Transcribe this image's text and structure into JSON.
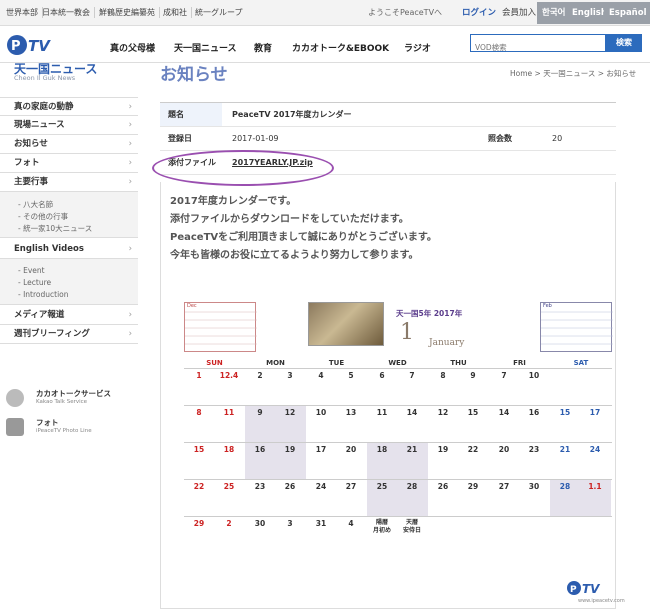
{
  "topbar": {
    "links": [
      "世界本部",
      "日本統一教会",
      "鮮鶴歴史編纂苑",
      "成和社",
      "統一グループ"
    ],
    "welcome": "ようこそPeaceTVへ",
    "login": "ログイン",
    "join": "会員加入",
    "langs": [
      "한국어",
      "English",
      "Español"
    ]
  },
  "header": {
    "logo": "PeaceTV",
    "nav": [
      "真の父母様",
      "天一国ニュース",
      "教育",
      "カカオトーク&EBOOK",
      "ラジオ"
    ],
    "search_placeholder": "VOD検索",
    "search_button": "検索"
  },
  "sidebar": {
    "title": "天一国ニュース",
    "subtitle": "Cheon Il Guk News",
    "menu1": [
      "真の家庭の動静",
      "現場ニュース",
      "お知らせ",
      "フォト",
      "主要行事"
    ],
    "sub1": [
      "- 八大名節",
      "- その他の行事",
      "- 統一家10大ニュース"
    ],
    "menu2": [
      "English Videos"
    ],
    "sub2": [
      "- Event",
      "- Lecture",
      "- Introduction"
    ],
    "menu3": [
      "メディア報道",
      "週刊ブリーフィング"
    ],
    "services": [
      {
        "title": "カカオトークサービス",
        "sub": "Kakao Talk Service",
        "icon": "kakao-icon"
      },
      {
        "title": "フォト",
        "sub": "iPeaceTV Photo Line",
        "icon": "camera-icon"
      }
    ]
  },
  "main": {
    "title": "お知らせ",
    "breadcrumb": "Home > 天一国ニュース > お知らせ",
    "subject_label": "題名",
    "subject": "PeaceTV 2017年度カレンダー",
    "date_label": "登録日",
    "date": "2017-01-09",
    "views_label": "照会数",
    "views": "20",
    "file_label": "添付ファイル",
    "file": "2017YEARLY.JP.zip",
    "body": [
      "2017年度カレンダーです。",
      "添付ファイルからダウンロードをしていただけます。",
      "PeaceTVをご利用頂きまして誠にありがとうございます。",
      "今年も皆様のお役に立てるようより努力して参ります。"
    ]
  },
  "calendar": {
    "year_title": "天一国5年 2017年",
    "month_num": "1",
    "month_name": "January",
    "prev_mini": "Dec",
    "next_mini": "Feb",
    "weekdays": [
      "SUN",
      "MON",
      "TUE",
      "WED",
      "THU",
      "FRI",
      "SAT"
    ],
    "weeks": [
      [
        "1",
        "12.4",
        "2",
        "3",
        "4",
        "5",
        "6",
        "7",
        "8",
        "9",
        "7",
        "10"
      ],
      [
        "8",
        "11",
        "9",
        "12",
        "10",
        "13",
        "11",
        "14",
        "12",
        "15",
        "14",
        "16",
        "15",
        "17"
      ],
      [
        "15",
        "18",
        "16",
        "19",
        "17",
        "20",
        "18",
        "21",
        "19",
        "22",
        "20",
        "23",
        "21",
        "24"
      ],
      [
        "22",
        "25",
        "23",
        "26",
        "24",
        "27",
        "25",
        "28",
        "26",
        "29",
        "27",
        "30",
        "28",
        "1.1"
      ],
      [
        "29",
        "2",
        "30",
        "3",
        "31",
        "4",
        "陽暦\n月初め",
        "天暦\n安侍日"
      ]
    ],
    "footer_logo": "PeaceTV",
    "footer_url": "www.ipeacetv.com"
  }
}
